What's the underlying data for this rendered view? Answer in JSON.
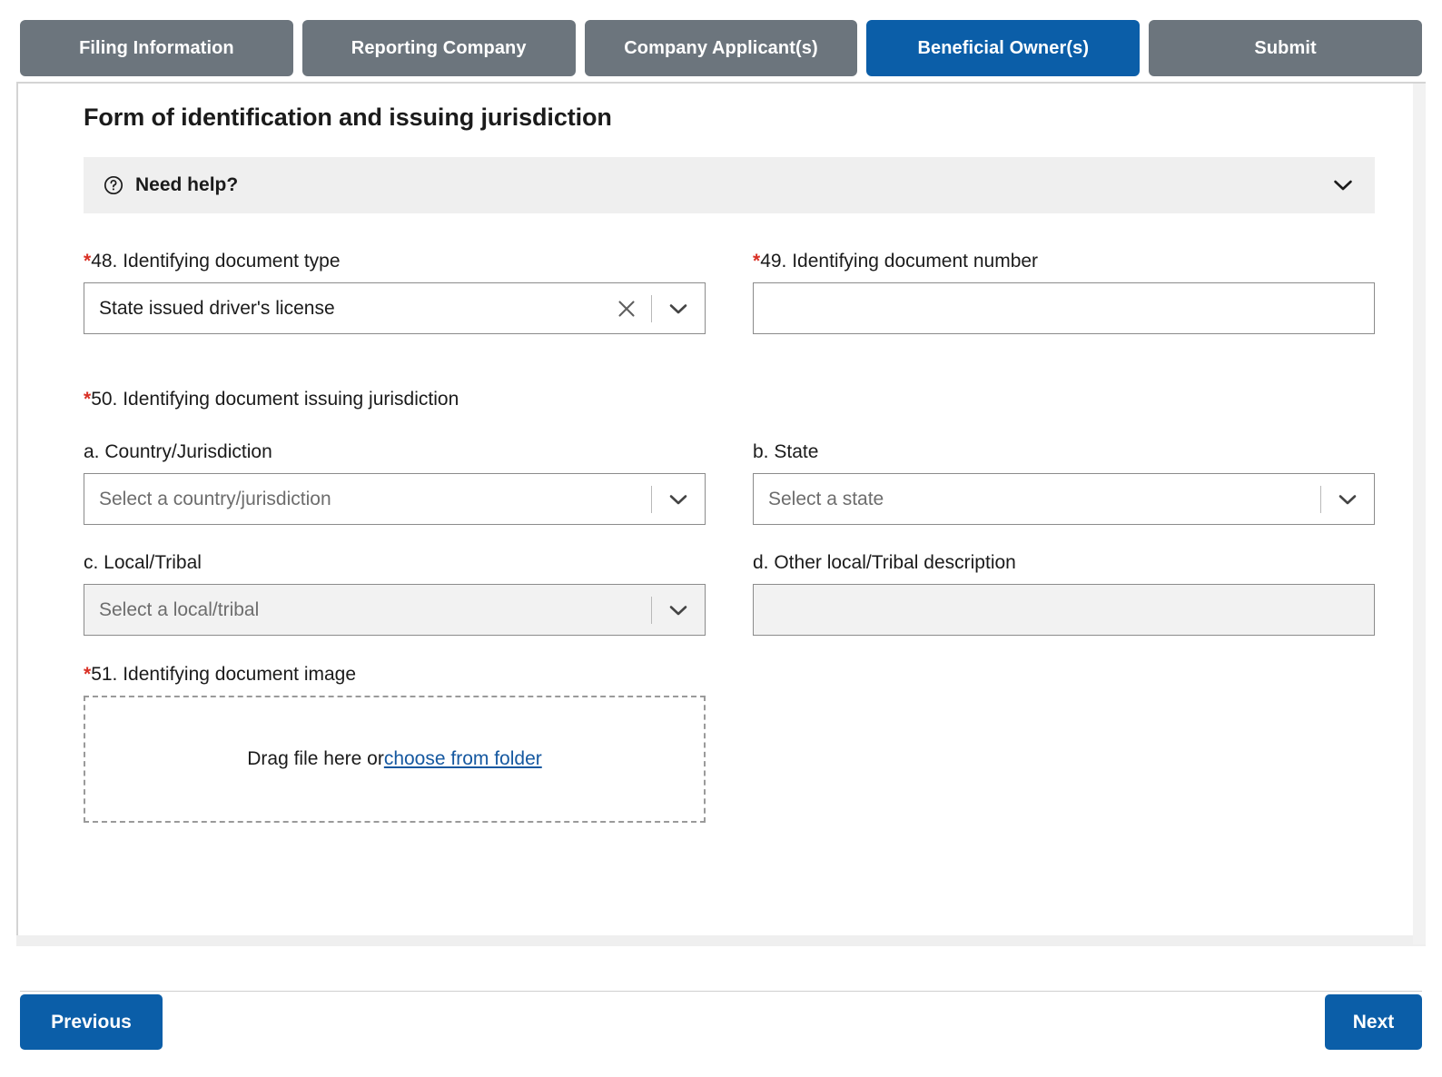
{
  "tabs": [
    {
      "label": "Filing Information",
      "active": false
    },
    {
      "label": "Reporting Company",
      "active": false
    },
    {
      "label": "Company Applicant(s)",
      "active": false
    },
    {
      "label": "Beneficial Owner(s)",
      "active": true
    },
    {
      "label": "Submit",
      "active": false
    }
  ],
  "section": {
    "title": "Form of identification and issuing jurisdiction"
  },
  "need_help": {
    "label": "Need help?",
    "icon": "question-circle-icon",
    "chevron": "chevron-down-icon",
    "expanded": false
  },
  "fields": {
    "doc_type": {
      "required_marker": "*",
      "label": "48. Identifying document type",
      "value": "State issued driver's license",
      "clear_icon": "close-x-icon",
      "caret_icon": "chevron-down-icon"
    },
    "doc_number": {
      "required_marker": "*",
      "label": "49. Identifying document number",
      "value": "",
      "placeholder": ""
    },
    "jurisdiction_group": {
      "required_marker": "*",
      "label": "50. Identifying document issuing jurisdiction"
    },
    "country": {
      "label": "a. Country/Jurisdiction",
      "placeholder": "Select a country/jurisdiction",
      "value": "",
      "caret_icon": "chevron-down-icon",
      "disabled": false
    },
    "state": {
      "label": "b. State",
      "placeholder": "Select a state",
      "value": "",
      "caret_icon": "chevron-down-icon",
      "disabled": false
    },
    "local_tribal": {
      "label": "c. Local/Tribal",
      "placeholder": "Select a local/tribal",
      "value": "",
      "caret_icon": "chevron-down-icon",
      "disabled": true
    },
    "other_local_tribal": {
      "label": "d. Other local/Tribal description",
      "placeholder": "",
      "value": "",
      "disabled": true
    },
    "doc_image": {
      "required_marker": "*",
      "label": "51. Identifying document image",
      "drop_text": "Drag file here or ",
      "link_text": "choose from folder"
    }
  },
  "footer": {
    "previous_label": "Previous",
    "next_label": "Next"
  },
  "colors": {
    "accent_blue": "#0b5ea8",
    "tab_inactive_gray": "#6c757d",
    "required_red": "#d93025",
    "link_blue": "#1558a0",
    "panel_gray": "#efefef",
    "disabled_gray": "#f2f2f2"
  }
}
